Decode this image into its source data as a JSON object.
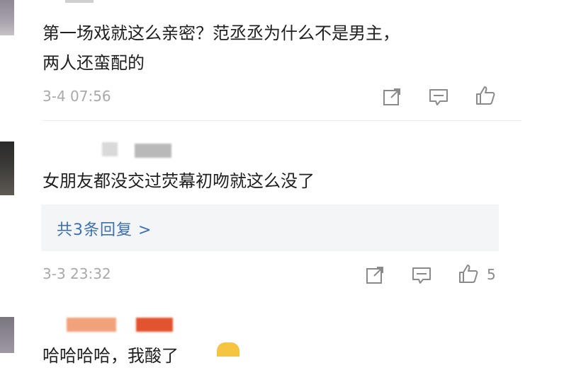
{
  "comments": [
    {
      "line1": "第一场戏就这么亲密？范丞丞为什么不是男主，",
      "line2": "两人还蛮配的",
      "timestamp": "3-4 07:56"
    },
    {
      "text": "女朋友都没交过荧幕初吻就这么没了",
      "replies_link": "共3条回复 >",
      "timestamp": "3-3 23:32",
      "like_count": "5"
    },
    {
      "text": "哈哈哈哈，我酸了"
    }
  ],
  "icons": {
    "share": "share-icon",
    "comment": "comment-icon",
    "like": "thumbs-up-icon"
  },
  "colors": {
    "reply_link": "#3d6fb2",
    "timestamp": "#a9a9a9",
    "icon": "#8a8a8a",
    "reply_box_bg": "#f4f5f7"
  }
}
